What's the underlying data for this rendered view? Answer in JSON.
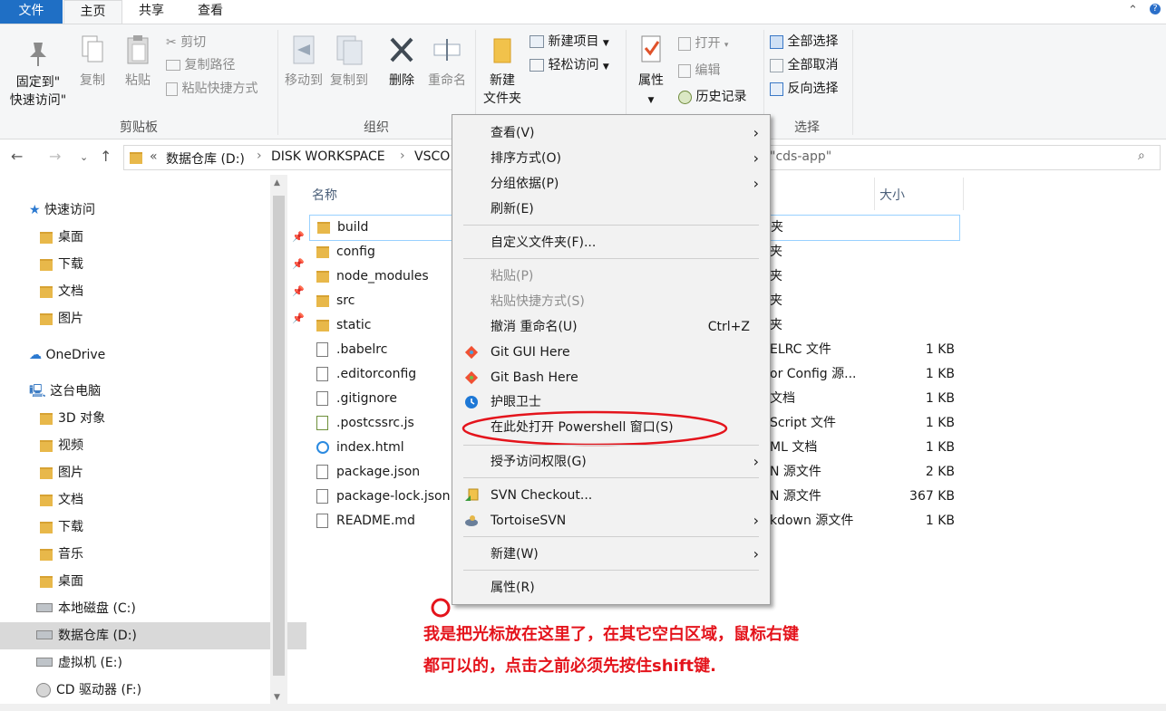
{
  "tabs": [
    "文件",
    "主页",
    "共享",
    "查看"
  ],
  "ribbon": {
    "clipboard": {
      "pin_label_1": "固定到\"",
      "pin_label_2": "快速访问\"",
      "copy": "复制",
      "paste": "粘贴",
      "cut": "剪切",
      "copy_path": "复制路径",
      "paste_shortcut": "粘贴快捷方式",
      "group": "剪贴板"
    },
    "organize": {
      "move_to": "移动到",
      "copy_to": "复制到",
      "delete": "删除",
      "rename": "重命名",
      "group": "组织"
    },
    "new": {
      "new_folder_1": "新建",
      "new_folder_2": "文件夹",
      "new_item": "新建项目",
      "easy_access": "轻松访问"
    },
    "open": {
      "properties": "属性",
      "open": "打开",
      "edit": "编辑",
      "history": "历史记录"
    },
    "select": {
      "select_all": "全部选择",
      "select_none": "全部取消",
      "invert": "反向选择",
      "group": "选择"
    }
  },
  "address": {
    "overflow": "«",
    "crumbs": [
      "数据仓库 (D:)",
      "DISK WORKSPACE",
      "VSCO"
    ],
    "search_placeholder": "\"cds-app\""
  },
  "nav": {
    "quick_access": "快速访问",
    "quick_items": [
      "桌面",
      "下载",
      "文档",
      "图片"
    ],
    "onedrive": "OneDrive",
    "this_pc": "这台电脑",
    "pc_items": [
      "3D 对象",
      "视频",
      "图片",
      "文档",
      "下载",
      "音乐",
      "桌面"
    ],
    "drives": [
      "本地磁盘 (C:)",
      "数据仓库 (D:)",
      "虚拟机 (E:)",
      "CD 驱动器 (F:)"
    ]
  },
  "columns": {
    "name": "名称",
    "size": "大小"
  },
  "files": [
    {
      "name": "build",
      "type": "夹",
      "size": ""
    },
    {
      "name": "config",
      "type": "夹",
      "size": ""
    },
    {
      "name": "node_modules",
      "type": "夹",
      "size": ""
    },
    {
      "name": "src",
      "type": "夹",
      "size": ""
    },
    {
      "name": "static",
      "type": "夹",
      "size": ""
    },
    {
      "name": ".babelrc",
      "type": "ELRC 文件",
      "size": "1 KB"
    },
    {
      "name": ".editorconfig",
      "type": "or Config 源...",
      "size": "1 KB"
    },
    {
      "name": ".gitignore",
      "type": "文档",
      "size": "1 KB"
    },
    {
      "name": ".postcssrc.js",
      "type": "Script 文件",
      "size": "1 KB"
    },
    {
      "name": "index.html",
      "type": "ML 文档",
      "size": "1 KB"
    },
    {
      "name": "package.json",
      "type": "N 源文件",
      "size": "2 KB"
    },
    {
      "name": "package-lock.json",
      "type": "N 源文件",
      "size": "367 KB"
    },
    {
      "name": "README.md",
      "type": "kdown 源文件",
      "size": "1 KB"
    }
  ],
  "menu": {
    "view": "查看(V)",
    "sort": "排序方式(O)",
    "group": "分组依据(P)",
    "refresh": "刷新(E)",
    "customize": "自定义文件夹(F)...",
    "paste": "粘贴(P)",
    "paste_shortcut": "粘贴快捷方式(S)",
    "undo": "撤消 重命名(U)",
    "undo_shortcut": "Ctrl+Z",
    "git_gui": "Git GUI Here",
    "git_bash": "Git Bash Here",
    "eye_guard": "护眼卫士",
    "powershell": "在此处打开 Powershell 窗口(S)",
    "access": "授予访问权限(G)",
    "svn_checkout": "SVN Checkout...",
    "tortoise": "TortoiseSVN",
    "new": "新建(W)",
    "properties": "属性(R)"
  },
  "annotation": {
    "line1": "我是把光标放在这里了，在其它空白区域，鼠标右键",
    "line2": "都可以的，点击之前必须先按住shift键."
  },
  "colors": {
    "accent": "#1f6fc5",
    "annotation": "#e4141c",
    "folder": "#e8b84a"
  }
}
